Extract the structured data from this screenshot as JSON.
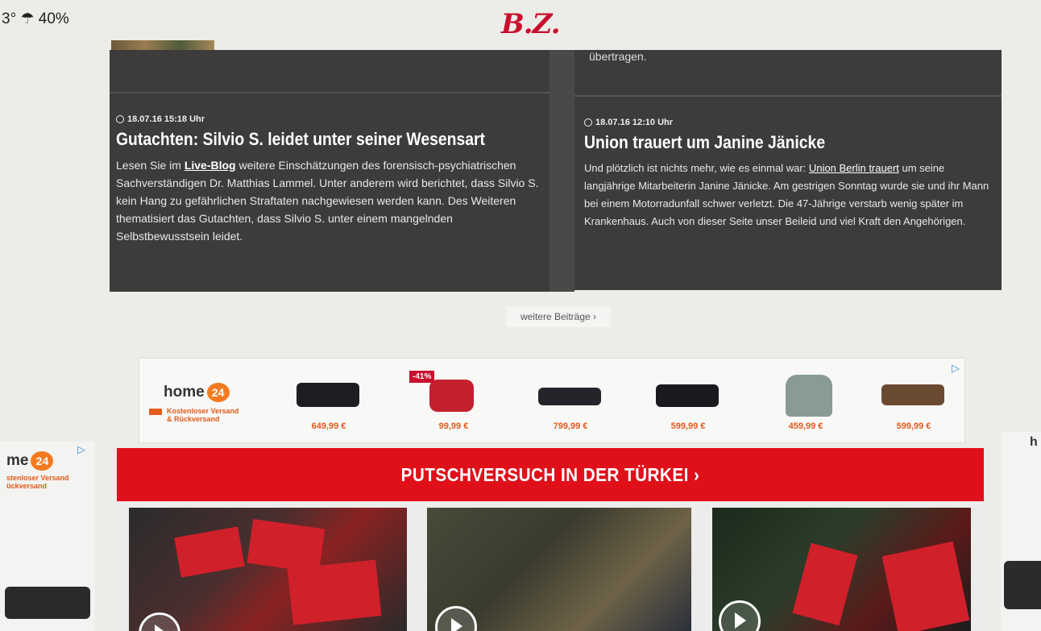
{
  "header": {
    "weather": "3° ☂ 40%",
    "logo": "B.Z."
  },
  "articles": [
    {
      "timestamp": "18.07.16 15:18 Uhr",
      "headline": "Gutachten: Silvio S. leidet unter seiner Wesensart",
      "text_before_link": "Lesen Sie im ",
      "link": "Live-Blog",
      "text_after_link": " weitere Einschätzungen des forensisch-psychiatrischen Sachverständigen Dr. Matthias Lammel. Unter anderem wird berichtet, dass Silvio S. kein Hang zu gefährlichen Straftaten nachgewiesen werden kann. Des Weiteren thematisiert das Gutachten, dass Silvio S. unter einem mangelnden Selbstbewusstsein leidet."
    },
    {
      "top_text": "übertragen.",
      "timestamp": "18.07.16 12:10 Uhr",
      "headline": "Union trauert um Janine Jänicke",
      "text_before_link": "Und plötzlich ist nichts mehr, wie es einmal war: ",
      "link": "Union Berlin trauert",
      "text_after_link": " um seine langjährige Mitarbeiterin Janine Jänicke. Am gestrigen Sonntag wurde sie und ihr Mann bei einem Motorradunfall schwer verletzt. Die 47-Jährige verstarb wenig später im Krankenhaus. Auch von dieser Seite unser Beileid und viel Kraft den Angehörigen."
    }
  ],
  "more_button": "weitere Beiträge ›",
  "ad": {
    "brand": "home",
    "badge": "24",
    "tagline_1": "Kostenloser Versand",
    "tagline_2": "& Rückversand",
    "arrow": "▷",
    "products": [
      {
        "price": "649,99 €",
        "color": "#1e1e22"
      },
      {
        "price": "99,99 €",
        "discount": "-41%",
        "color": "#c4202e"
      },
      {
        "price": "799,99 €",
        "color": "#24242a"
      },
      {
        "price": "599,99 €",
        "color": "#1a1a1e"
      },
      {
        "price": "459,99 €",
        "color": "#8a9a96"
      },
      {
        "price": "599,99 €",
        "color": "#6b4a32"
      }
    ]
  },
  "side_ad_left": {
    "brand": "me",
    "badge": "24",
    "tagline_1": "stenloser Versand",
    "tagline_2": "ückversand",
    "arrow": "▷"
  },
  "side_ad_right": {
    "letter": "h"
  },
  "banner": {
    "title": "PUTSCHVERSUCH IN DER TÜRKEI ›"
  }
}
